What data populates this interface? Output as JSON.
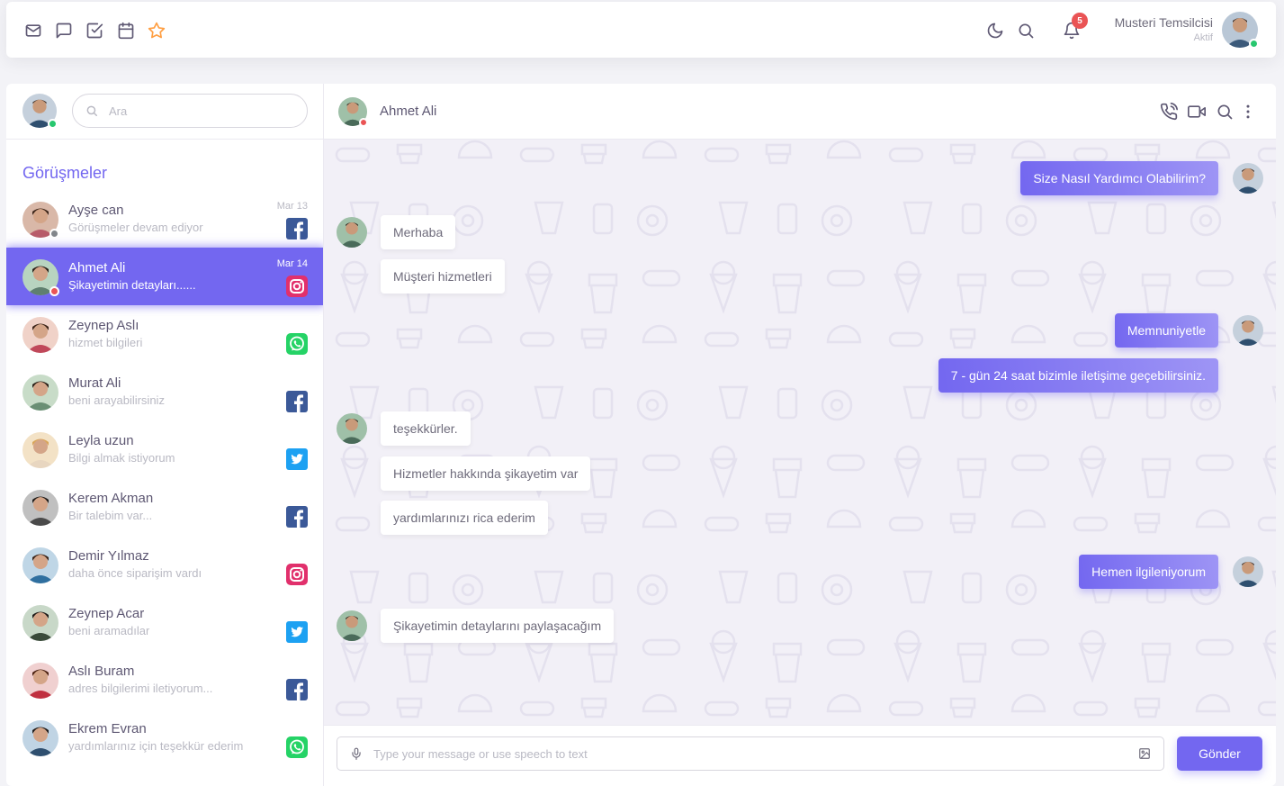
{
  "colors": {
    "accent": "#7367f0",
    "online": "#28c76f",
    "busy": "#ea5455"
  },
  "navbar": {
    "left_icons": [
      "mail-icon",
      "message-square-icon",
      "check-square-icon",
      "calendar-icon",
      "star-icon"
    ],
    "right_icons": [
      "moon-icon",
      "search-icon",
      "bell-icon"
    ],
    "notification_count": "5",
    "user_name": "Musteri Temsilcisi",
    "user_status": "Aktif"
  },
  "sidebar": {
    "search_placeholder": "Ara",
    "section_title": "Görüşmeler",
    "chats": [
      {
        "name": "Ayşe can",
        "message": "Görüşmeler devam ediyor",
        "time": "Mar 13",
        "channel": "facebook"
      },
      {
        "name": "Ahmet Ali",
        "message": "Şikayetimin detayları......",
        "time": "Mar 14",
        "channel": "instagram"
      },
      {
        "name": "Zeynep Aslı",
        "message": "hizmet bilgileri",
        "time": "",
        "channel": "whatsapp"
      },
      {
        "name": "Murat Ali",
        "message": "beni arayabilirsiniz",
        "time": "",
        "channel": "facebook"
      },
      {
        "name": "Leyla uzun",
        "message": "Bilgi almak istiyorum",
        "time": "",
        "channel": "twitter"
      },
      {
        "name": "Kerem Akman",
        "message": "Bir talebim var...",
        "time": "",
        "channel": "facebook"
      },
      {
        "name": "Demir Yılmaz",
        "message": "daha önce siparişim vardı",
        "time": "",
        "channel": "instagram"
      },
      {
        "name": "Zeynep Acar",
        "message": "beni aramadılar",
        "time": "",
        "channel": "twitter"
      },
      {
        "name": "Aslı Buram",
        "message": "adres bilgilerimi iletiyorum...",
        "time": "",
        "channel": "facebook"
      },
      {
        "name": "Ekrem Evran",
        "message": "yardımlarınız için teşekkür ederim",
        "time": "",
        "channel": "whatsapp"
      }
    ]
  },
  "chat": {
    "contact_name": "Ahmet Ali",
    "header_icons": [
      "phone-call-icon",
      "video-icon",
      "search-icon",
      "more-vertical-icon"
    ],
    "messages": [
      {
        "side": "out",
        "text": "Size Nasıl Yardımcı Olabilirim?"
      },
      {
        "side": "in",
        "text": "Merhaba"
      },
      {
        "side": "in",
        "text": "Müşteri hizmetleri"
      },
      {
        "side": "out",
        "text": "Memnuniyetle"
      },
      {
        "side": "out",
        "text": "7 - gün 24 saat bizimle iletişime geçebilirsiniz."
      },
      {
        "side": "in",
        "text": "teşekkürler."
      },
      {
        "side": "in",
        "text": "Hizmetler hakkında şikayetim var"
      },
      {
        "side": "in",
        "text": "yardımlarınızı rica ederim"
      },
      {
        "side": "out",
        "text": "Hemen ilgileniyorum"
      },
      {
        "side": "in",
        "text": "Şikayetimin detaylarını paylaşacağım"
      }
    ],
    "input_placeholder": "Type your message or use speech to text",
    "send_label": "Gönder"
  }
}
